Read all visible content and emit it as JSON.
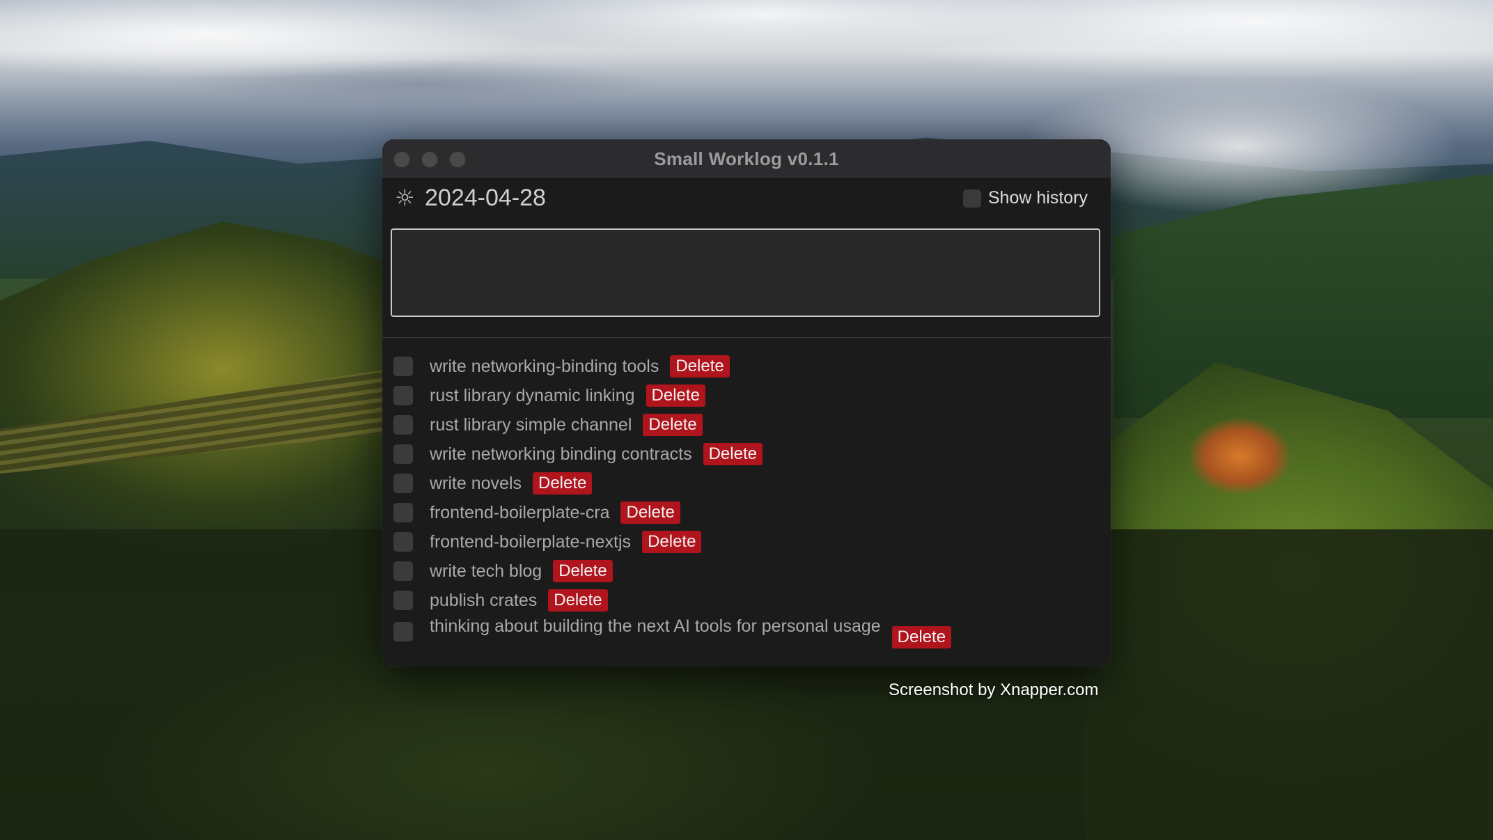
{
  "window": {
    "title": "Small Worklog v0.1.1"
  },
  "header": {
    "sun_icon": "sun-icon",
    "date": "2024-04-28",
    "show_history_label": "Show history"
  },
  "editor": {
    "value": "",
    "placeholder": ""
  },
  "tasks": [
    {
      "label": "write networking-binding tools",
      "delete_label": "Delete",
      "checked": false
    },
    {
      "label": "rust library dynamic linking",
      "delete_label": "Delete",
      "checked": false
    },
    {
      "label": "rust library simple channel",
      "delete_label": "Delete",
      "checked": false
    },
    {
      "label": "write networking binding contracts",
      "delete_label": "Delete",
      "checked": false
    },
    {
      "label": "write novels",
      "delete_label": "Delete",
      "checked": false
    },
    {
      "label": "frontend-boilerplate-cra",
      "delete_label": "Delete",
      "checked": false
    },
    {
      "label": "frontend-boilerplate-nextjs",
      "delete_label": "Delete",
      "checked": false
    },
    {
      "label": "write tech blog",
      "delete_label": "Delete",
      "checked": false
    },
    {
      "label": "publish crates",
      "delete_label": "Delete",
      "checked": false
    },
    {
      "label": "thinking about building the next AI tools for personal usage",
      "delete_label": "Delete",
      "checked": false
    }
  ],
  "watermark": "Screenshot by Xnapper.com",
  "colors": {
    "delete_bg": "#b0141c",
    "window_bg": "#1b1b1c",
    "titlebar_bg": "#2c2c2e"
  }
}
